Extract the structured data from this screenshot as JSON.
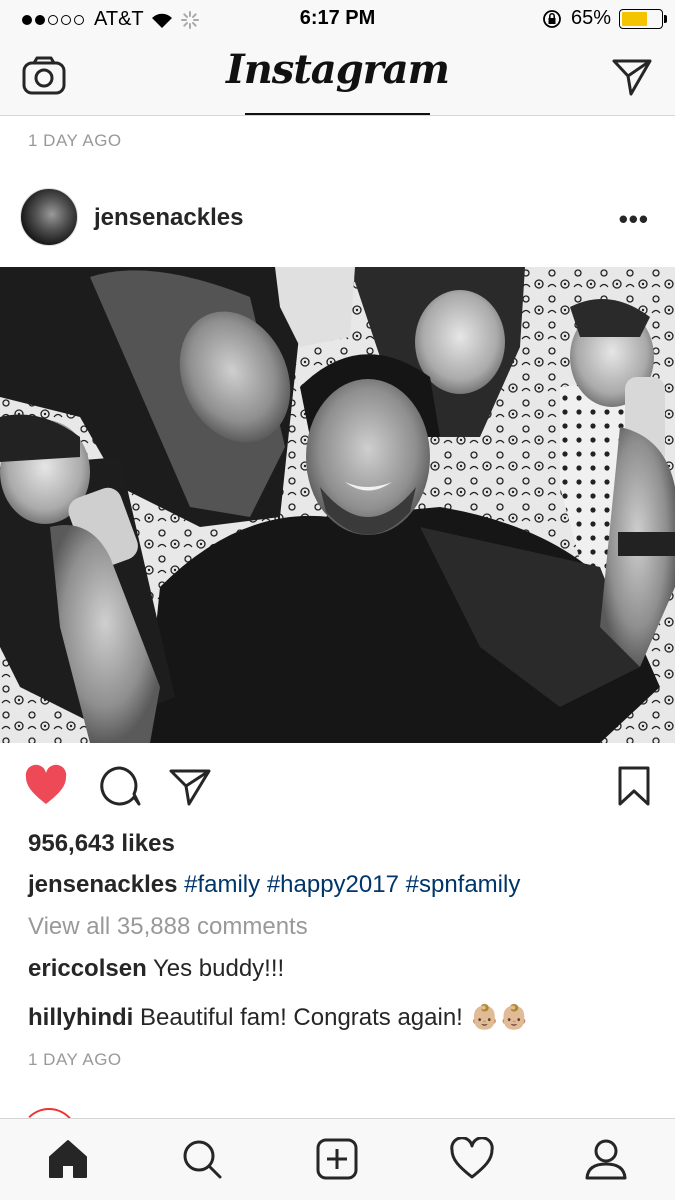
{
  "status_bar": {
    "carrier": "AT&T",
    "time": "6:17 PM",
    "battery": "65%",
    "battery_level": 0.65
  },
  "header": {
    "logo": "Instagram"
  },
  "prev_post_time": "1 DAY AGO",
  "post": {
    "username": "jensenackles",
    "more_label": "•••",
    "likes": "956,643 likes",
    "caption_user": "jensenackles",
    "hashtags": [
      "#family",
      "#happy2017",
      "#spnfamily"
    ],
    "view_all": "View all 35,888 comments",
    "comments": [
      {
        "user": "ericcolsen",
        "text": "Yes buddy!!!"
      },
      {
        "user": "hillyhindi",
        "text": "Beautiful fam! Congrats again! 👶🏼👶🏼"
      }
    ],
    "time": "1 DAY AGO",
    "liked": true
  },
  "colors": {
    "like_red": "#ed4956",
    "hashtag": "#003569",
    "muted": "#999999",
    "battery": "#f5c400"
  },
  "icons": {
    "header": [
      "camera-icon",
      "direct-send-icon"
    ],
    "actions": [
      "heart-filled-icon",
      "comment-icon",
      "share-icon",
      "bookmark-icon"
    ],
    "tabs": [
      "home-icon",
      "search-icon",
      "add-post-icon",
      "activity-heart-icon",
      "profile-icon"
    ]
  }
}
